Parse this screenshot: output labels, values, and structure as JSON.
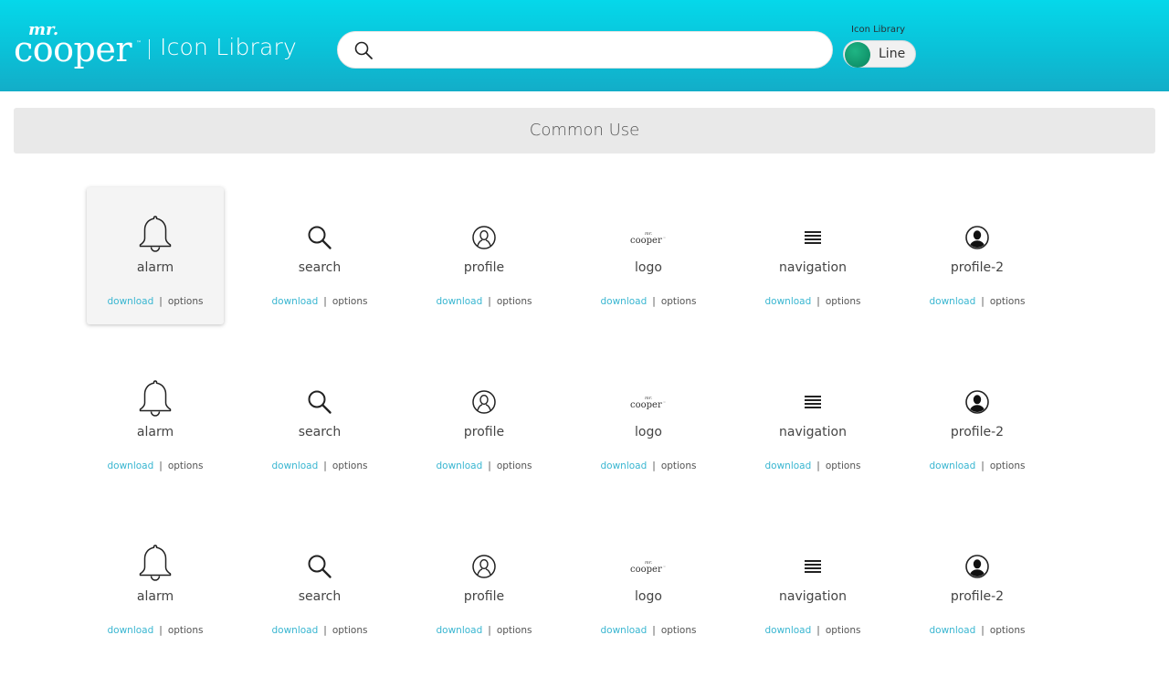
{
  "header": {
    "brand_mr": "mr.",
    "brand_cooper": "cooper",
    "brand_tm": "™",
    "brand_title": "Icon Library",
    "search_placeholder": "",
    "library_label": "Icon Library",
    "toggle_label": "Line",
    "accent_color": "#05d8ea",
    "toggle_color": "#10936a"
  },
  "section": {
    "title": "Common Use"
  },
  "rows": [
    {
      "items": [
        {
          "name": "alarm",
          "icon": "bell-icon",
          "download": "download",
          "options": "options",
          "active": true
        },
        {
          "name": "search",
          "icon": "search-icon",
          "download": "download",
          "options": "options"
        },
        {
          "name": "profile",
          "icon": "profile-outline-icon",
          "download": "download",
          "options": "options"
        },
        {
          "name": "logo",
          "icon": "mr-cooper-logo-icon",
          "download": "download",
          "options": "options"
        },
        {
          "name": "navigation",
          "icon": "menu-lines-icon",
          "download": "download",
          "options": "options"
        },
        {
          "name": "profile-2",
          "icon": "profile-filled-icon",
          "download": "download",
          "options": "options"
        }
      ]
    },
    {
      "items": [
        {
          "name": "alarm",
          "icon": "bell-icon",
          "download": "download",
          "options": "options"
        },
        {
          "name": "search",
          "icon": "search-icon",
          "download": "download",
          "options": "options"
        },
        {
          "name": "profile",
          "icon": "profile-outline-icon",
          "download": "download",
          "options": "options"
        },
        {
          "name": "logo",
          "icon": "mr-cooper-logo-icon",
          "download": "download",
          "options": "options"
        },
        {
          "name": "navigation",
          "icon": "menu-lines-icon",
          "download": "download",
          "options": "options"
        },
        {
          "name": "profile-2",
          "icon": "profile-filled-icon",
          "download": "download",
          "options": "options"
        }
      ]
    },
    {
      "items": [
        {
          "name": "alarm",
          "icon": "bell-icon",
          "download": "download",
          "options": "options"
        },
        {
          "name": "search",
          "icon": "search-icon",
          "download": "download",
          "options": "options"
        },
        {
          "name": "profile",
          "icon": "profile-outline-icon",
          "download": "download",
          "options": "options"
        },
        {
          "name": "logo",
          "icon": "mr-cooper-logo-icon",
          "download": "download",
          "options": "options"
        },
        {
          "name": "navigation",
          "icon": "menu-lines-icon",
          "download": "download",
          "options": "options"
        },
        {
          "name": "profile-2",
          "icon": "profile-filled-icon",
          "download": "download",
          "options": "options"
        }
      ]
    }
  ]
}
